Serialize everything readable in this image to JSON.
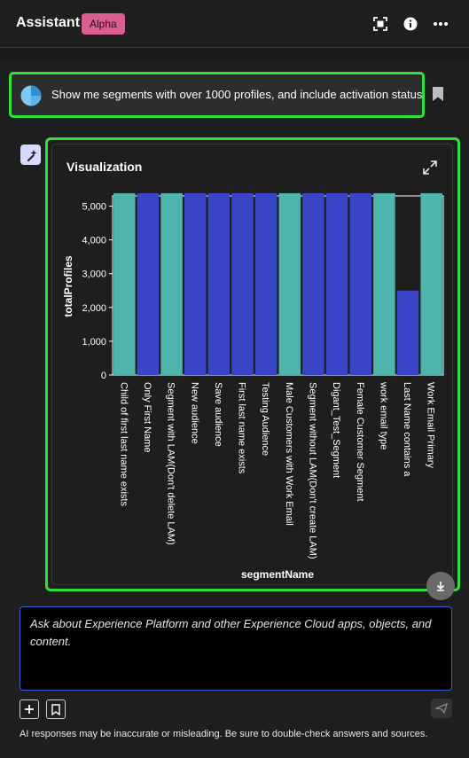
{
  "header": {
    "title": "Assistant",
    "badge": "Alpha",
    "icons": [
      "fullscreen-icon",
      "info-icon",
      "more-icon"
    ]
  },
  "prompt": {
    "text": "Show me segments with over 1000 profiles, and include activation status"
  },
  "visualization": {
    "title": "Visualization"
  },
  "chart_data": {
    "type": "bar",
    "xlabel": "segmentName",
    "ylabel": "totalProfiles",
    "ylim": [
      0,
      5300
    ],
    "yticks": [
      0,
      1000,
      2000,
      3000,
      4000,
      5000
    ],
    "ytick_labels": [
      "0",
      "1,000",
      "2,000",
      "3,000",
      "4,000",
      "5,000"
    ],
    "categories": [
      "Child of first last name exists",
      "Only First Name",
      "Segment with LAM(Don't delete LAM)",
      "New audience",
      "Save audience",
      "First last name exists",
      "Testing Audience",
      "Male Customers with Work Email",
      "Segment without LAM(Don't create LAM)",
      "Digant_Test_Segment",
      "Female Customer Segment",
      "work email type",
      "Last Name contains a",
      "Work Email Primary"
    ],
    "values": [
      5380,
      5380,
      5380,
      5380,
      5380,
      5380,
      5380,
      5380,
      5380,
      5380,
      5380,
      5380,
      2500,
      5380
    ],
    "bar_colors": [
      "#4fb4ab",
      "#3a45c8",
      "#4fb4ab",
      "#3a45c8",
      "#3a45c8",
      "#3a45c8",
      "#3a45c8",
      "#4fb4ab",
      "#3a45c8",
      "#3a45c8",
      "#3a45c8",
      "#4fb4ab",
      "#3a45c8",
      "#4fb4ab"
    ],
    "grid": false,
    "legend": "none"
  },
  "input": {
    "placeholder": "Ask about Experience Platform and other Experience Cloud apps, objects, and content."
  },
  "footer": {
    "disclaimer": "AI responses may be inaccurate or misleading. Be sure to double-check answers and sources."
  },
  "colors": {
    "accent_highlight": "#2ee23a",
    "badge": "#d95d91",
    "input_border": "#3c62d6"
  }
}
